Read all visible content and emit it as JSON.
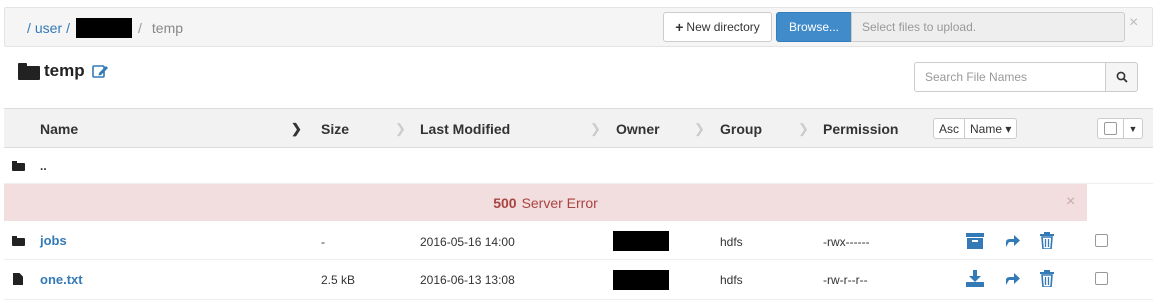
{
  "breadcrumb": {
    "sep": "/",
    "root": "user",
    "current": "temp"
  },
  "toolbar": {
    "new_dir_icon": "plus-icon",
    "new_dir_label": "New directory",
    "browse_label": "Browse...",
    "upload_placeholder": "Select files to upload.",
    "close": "×"
  },
  "page": {
    "title": "temp",
    "edit_icon": "pencil-square-icon"
  },
  "search": {
    "placeholder": "Search File Names",
    "icon": "search-icon"
  },
  "columns": {
    "name": "Name",
    "size": "Size",
    "modified": "Last Modified",
    "owner": "Owner",
    "group": "Group",
    "permission": "Permission"
  },
  "sort": {
    "order": "Asc",
    "by": "Name ▾"
  },
  "parent_row": {
    "name": ".."
  },
  "error": {
    "code": "500",
    "message": "Server Error",
    "close": "×"
  },
  "rows": [
    {
      "type": "folder",
      "name": "jobs",
      "size": "-",
      "modified": "2016-05-16 14:00",
      "group": "hdfs",
      "permission": "-rwx------",
      "actions": [
        "archive-icon",
        "move-icon",
        "trash-icon"
      ]
    },
    {
      "type": "file",
      "name": "one.txt",
      "size": "2.5 kB",
      "modified": "2016-06-13 13:08",
      "group": "hdfs",
      "permission": "-rw-r--r--",
      "actions": [
        "download-icon",
        "move-icon",
        "trash-icon"
      ]
    }
  ],
  "colors": {
    "link": "#337ab7",
    "primary": "#428bca",
    "error_bg": "#f2dede",
    "error_text": "#a94442"
  }
}
